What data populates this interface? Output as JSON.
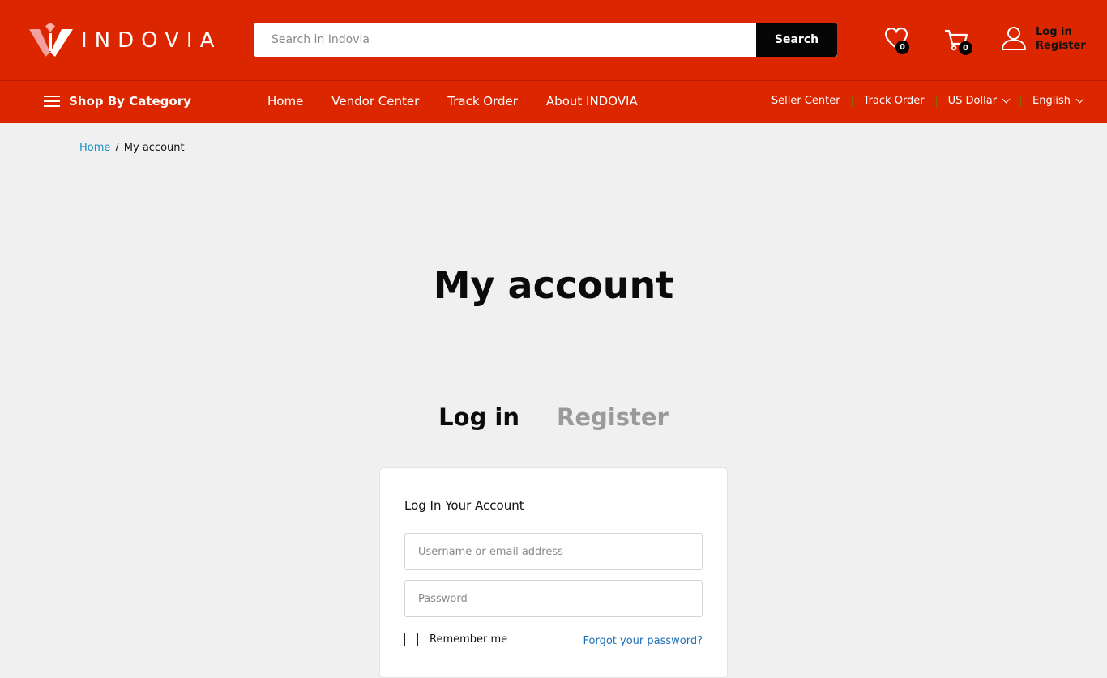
{
  "header": {
    "logo_text": "INDOVIA",
    "search_placeholder": "Search in Indovia",
    "search_button": "Search",
    "wishlist_count": "0",
    "cart_count": "0",
    "login_link": "Log in",
    "register_link": "Register"
  },
  "nav": {
    "category_label": "Shop By Category",
    "items": [
      "Home",
      "Vendor Center",
      "Track Order",
      "About INDOVIA"
    ],
    "utility": {
      "seller_center": "Seller Center",
      "track_order": "Track Order",
      "currency": "US Dollar",
      "language": "English"
    }
  },
  "breadcrumb": {
    "home": "Home",
    "separator": "/",
    "current": "My account"
  },
  "page": {
    "title": "My account",
    "tab_login": "Log in",
    "tab_register": "Register"
  },
  "login_form": {
    "title": "Log In Your Account",
    "username_placeholder": "Username or email address",
    "password_placeholder": "Password",
    "remember_label": "Remember me",
    "forgot_link": "Forgot your password?"
  },
  "colors": {
    "brand_red": "#dc2600",
    "link_blue": "#1a8fc4",
    "button_black": "#050505"
  }
}
